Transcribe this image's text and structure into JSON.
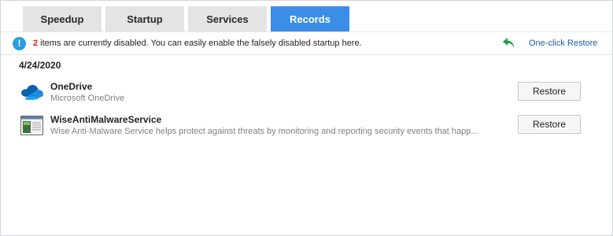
{
  "tabs": [
    {
      "label": "Speedup",
      "active": false
    },
    {
      "label": "Startup",
      "active": false
    },
    {
      "label": "Services",
      "active": false
    },
    {
      "label": "Records",
      "active": true
    }
  ],
  "info": {
    "count": "2",
    "message": " items are currently disabled. You can easily enable the falsely disabled startup here.",
    "icon": "info-icon",
    "restore_all_label": "One-click Restore",
    "restore_all_icon": "undo-arrow-icon"
  },
  "date": "4/24/2020",
  "records": [
    {
      "name": "OneDrive",
      "description": "Microsoft OneDrive",
      "icon": "onedrive-cloud-icon",
      "button_label": "Restore"
    },
    {
      "name": "WiseAntiMalwareService",
      "description": "Wise Anti-Malware Service helps protect against threats by monitoring and reporting security events that happ...",
      "icon": "service-window-icon",
      "button_label": "Restore"
    }
  ],
  "colors": {
    "active_tab": "#3b8ee8",
    "inactive_tab": "#e4e4e4",
    "link": "#1e5ea8",
    "count": "#d32222",
    "info_icon": "#2b9be0",
    "undo_arrow": "#2a9a4a"
  }
}
